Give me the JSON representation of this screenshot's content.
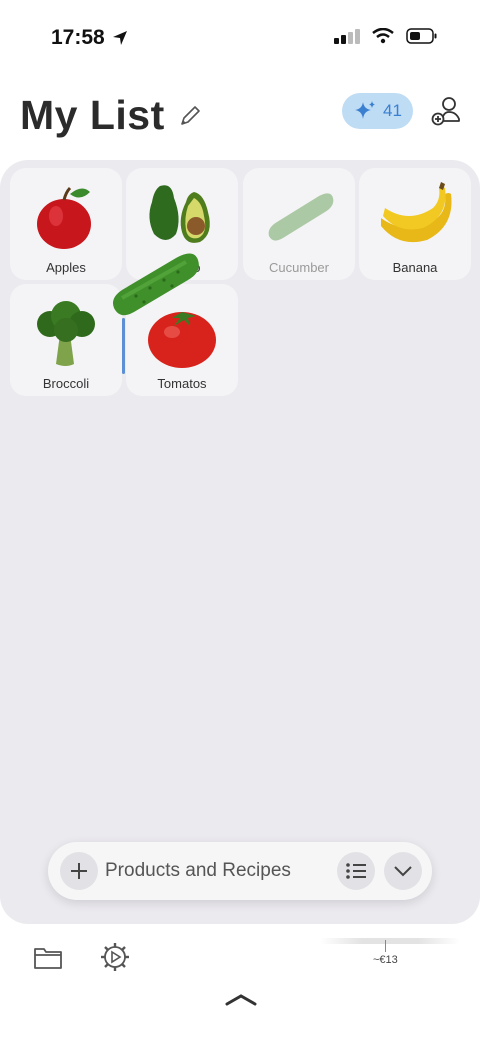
{
  "status_bar": {
    "time": "17:58",
    "icons": [
      "location-arrow-icon",
      "cellular-signal-icon",
      "wifi-icon",
      "battery-icon"
    ]
  },
  "header": {
    "title": "My List",
    "ai_badge_count": "41",
    "icons": [
      "pencil-icon",
      "sparkle-icon",
      "add-person-icon"
    ]
  },
  "items": [
    {
      "label": "Apples",
      "icon": "apple-icon"
    },
    {
      "label": "Avocado",
      "visible_label": "do",
      "icon": "avocado-icon"
    },
    {
      "label": "Cucumber",
      "icon": "cucumber-icon",
      "state": "dragging"
    },
    {
      "label": "Banana",
      "icon": "banana-icon"
    },
    {
      "label": "Broccoli",
      "icon": "broccoli-icon"
    },
    {
      "label": "Tomatos",
      "icon": "tomato-icon"
    }
  ],
  "input_bar": {
    "placeholder": "Products and Recipes",
    "icons": [
      "plus-icon",
      "list-icon",
      "chevron-down-icon"
    ]
  },
  "tab_bar": {
    "icons": [
      "folder-icon",
      "settings-icon"
    ],
    "price": "~€13"
  },
  "colors": {
    "board_bg": "#ebeaef",
    "tile_bg": "#f4f4f6",
    "ai_badge_bg": "#bfdcf5",
    "accent_blue": "#3a7fd0"
  }
}
